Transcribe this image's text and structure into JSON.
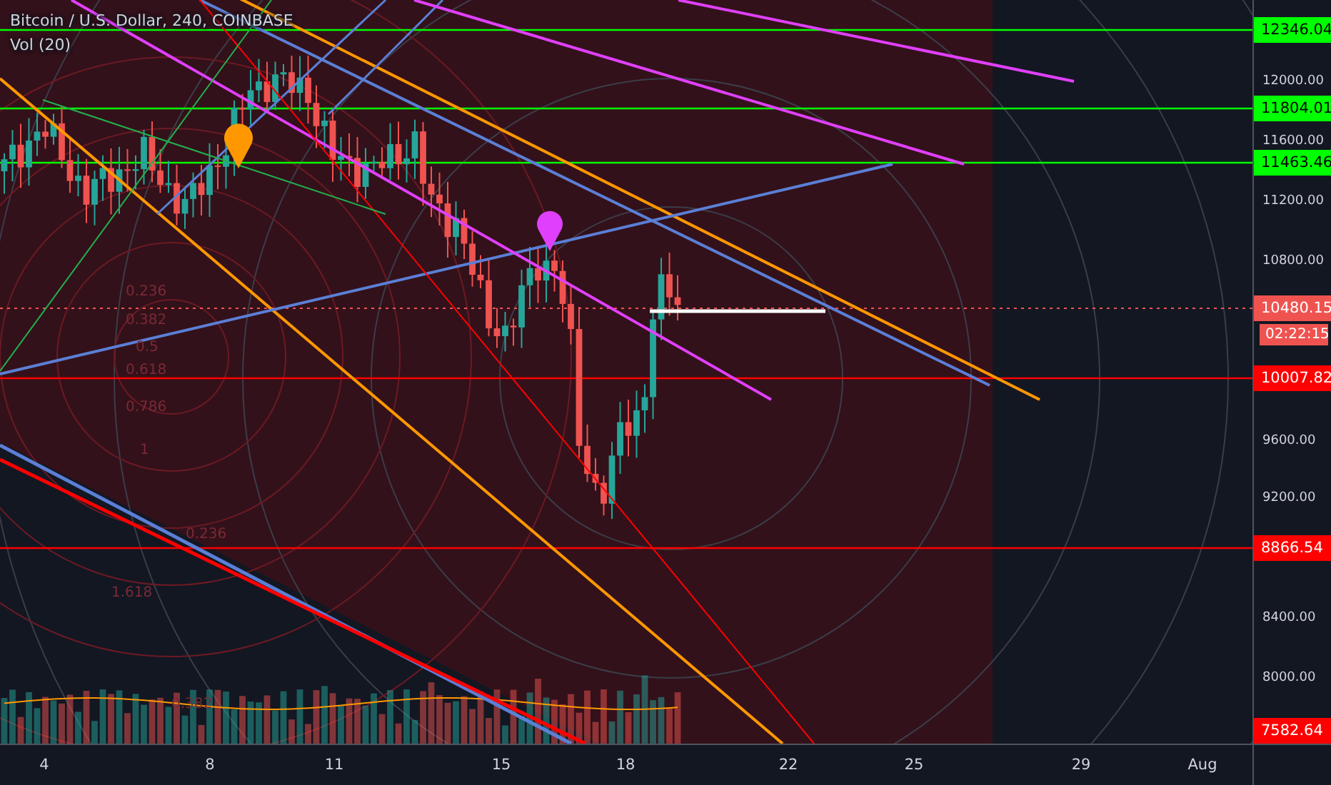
{
  "legend": {
    "title": "Bitcoin / U.S. Dollar, 240, COINBASE",
    "indicator": "Vol (20)"
  },
  "fib_labels": [
    "0.236",
    "0.382",
    "0.5",
    "0.618",
    "0.786",
    "1",
    "0.236",
    "1.618",
    "0.382"
  ],
  "price_axis": {
    "ticks": [
      "12000.00",
      "11600.00",
      "11200.00",
      "10800.00",
      "9600.00",
      "9200.00",
      "8400.00",
      "8000.00"
    ]
  },
  "price_tags": [
    {
      "text": "12346.04",
      "color": "#00ff00"
    },
    {
      "text": "11804.01",
      "color": "#00ff00"
    },
    {
      "text": "11463.46",
      "color": "#00ff00"
    },
    {
      "text": "10480.15",
      "color": "#ef5350",
      "countdown": "02:22:15"
    },
    {
      "text": "10007.82",
      "color": "#ff0000"
    },
    {
      "text": "8866.54",
      "color": "#ff0000"
    },
    {
      "text": "7582.64",
      "color": "#ff0000"
    }
  ],
  "time_axis": {
    "ticks": [
      "4",
      "8",
      "11",
      "15",
      "18",
      "22",
      "25",
      "29",
      "Aug"
    ]
  }
}
